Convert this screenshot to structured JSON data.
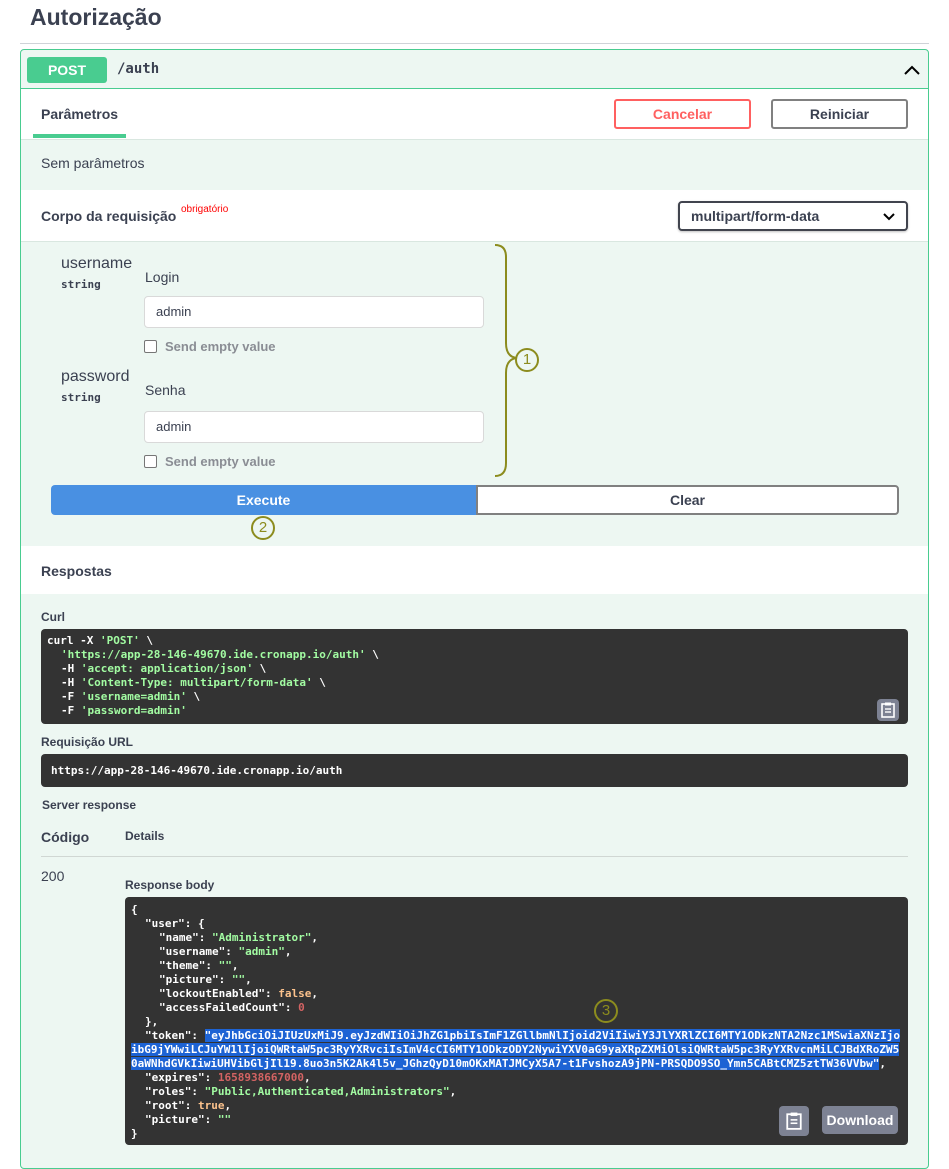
{
  "page": {
    "title": "Autorização"
  },
  "endpoint": {
    "method": "POST",
    "path": "/auth"
  },
  "tabs": {
    "parameters": "Parâmetros",
    "cancel": "Cancelar",
    "reset": "Reiniciar"
  },
  "no_params": "Sem parâmetros",
  "request_body": {
    "title": "Corpo da requisição",
    "required": "obrigatório",
    "content_type": "multipart/form-data"
  },
  "fields": [
    {
      "name": "username",
      "type": "string",
      "label": "Login",
      "value": "admin",
      "send_empty": "Send empty value"
    },
    {
      "name": "password",
      "type": "string",
      "label": "Senha",
      "value": "admin",
      "send_empty": "Send empty value"
    }
  ],
  "annotations": {
    "one": "1",
    "two": "2",
    "three": "3"
  },
  "actions": {
    "execute": "Execute",
    "clear": "Clear"
  },
  "responses": {
    "title": "Respostas",
    "curl_label": "Curl",
    "curl": {
      "l1_cmd": "curl -X ",
      "l1_str": "'POST'",
      "l1_end": " \\",
      "l2_str": "'https://app-28-146-49670.ide.cronapp.io/auth'",
      "l2_end": " \\",
      "l3_cmd": "-H ",
      "l3_str": "'accept: application/json'",
      "l3_end": " \\",
      "l4_cmd": "-H ",
      "l4_str": "'Content-Type: multipart/form-data'",
      "l4_end": " \\",
      "l5_cmd": "-F ",
      "l5_str": "'username=admin'",
      "l5_end": " \\",
      "l6_cmd": "-F ",
      "l6_str": "'password=admin'"
    },
    "request_url_label": "Requisição URL",
    "request_url": "https://app-28-146-49670.ide.cronapp.io/auth",
    "server_response": "Server response",
    "code_header": "Código",
    "details_header": "Details",
    "status_code": "200",
    "response_body_label": "Response body",
    "download": "Download",
    "body": {
      "open": "{",
      "user_key": "\"user\"",
      "user_open": ": {",
      "name_key": "\"name\"",
      "name_val": "\"Administrator\"",
      "username_key": "\"username\"",
      "username_val": "\"admin\"",
      "theme_key": "\"theme\"",
      "theme_val": "\"\"",
      "picture_key": "\"picture\"",
      "picture_val": "\"\"",
      "lockout_key": "\"lockoutEnabled\"",
      "lockout_val": "false",
      "afc_key": "\"accessFailedCount\"",
      "afc_val": "0",
      "user_close": "},",
      "token_key": "\"token\"",
      "token_l1": "\"eyJhbGciOiJIUzUxMiJ9.eyJzdWIiOiJhZG1pbiIsImF1ZGllbmNlIjoid2ViIiwiY3JlYXRlZCI6MTY1ODkzNTA2Nzc1MSwiaXNzIjo",
      "token_l2": "ibG9jYWwiLCJuYW1lIjoiQWRtaW5pc3RyYXRvciIsImV4cCI6MTY1ODkzODY2NywiYXV0aG9yaXRpZXMiOlsiQWRtaW5pc3RyYXRvcnMiLCJBdXRoZW5",
      "token_l3": "0aWNhdGVkIiwiUHVibGljIl19.8uo3n5K2Ak4l5v_JGhzQyD10mOKxMATJMCyX5A7-t1FvshozA9jPN-PRSQDO9SO_Ymn5CABtCMZ5ztTW36VVbw\"",
      "expires_key": "\"expires\"",
      "expires_val": "1658938667000",
      "roles_key": "\"roles\"",
      "roles_val": "\"Public,Authenticated,Administrators\"",
      "root_key": "\"root\"",
      "root_val": "true",
      "picture2_key": "\"picture\"",
      "picture2_val": "\"\"",
      "close": "}"
    }
  },
  "colors": {
    "post_green": "#49cc90",
    "execute_blue": "#4990e2",
    "cancel_red": "#ff6060",
    "annotation_olive": "#8c8c1e"
  }
}
